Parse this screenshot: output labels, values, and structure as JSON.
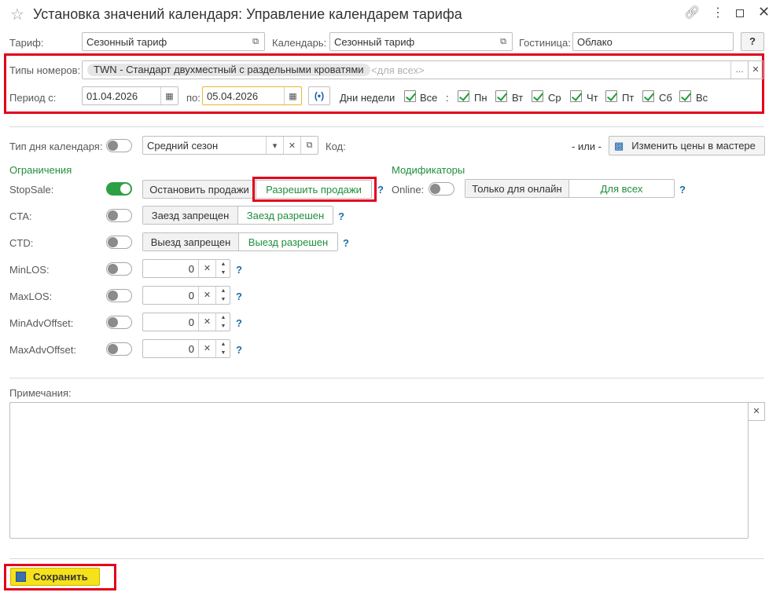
{
  "title": "Установка значений календаря: Управление календарем тарифа",
  "header": {
    "tariff_label": "Тариф:",
    "tariff_value": "Сезонный тариф",
    "calendar_label": "Календарь:",
    "calendar_value": "Сезонный тариф",
    "hotel_label": "Гостиница:",
    "hotel_value": "Облако",
    "help": "?"
  },
  "filters": {
    "room_types_label": "Типы номеров:",
    "room_type_tag": "TWN - Стандарт двухместный с раздельными кроватями",
    "room_types_placeholder": "<для всех>",
    "period_label": "Период с:",
    "date_from": "01.04.2026",
    "to_label": "по:",
    "date_to": "05.04.2026",
    "weekdays_label": "Дни недели",
    "all_label": "Все",
    "colon": ":",
    "days": [
      "Пн",
      "Вт",
      "Ср",
      "Чт",
      "Пт",
      "Сб",
      "Вс"
    ]
  },
  "day_type": {
    "label": "Тип дня календаря:",
    "value": "Средний сезон",
    "code_label": "Код:",
    "or": "- или -",
    "wizard_button": "Изменить цены в мастере"
  },
  "restrictions": {
    "heading": "Ограничения",
    "stopsale": {
      "label": "StopSale:",
      "btn1": "Остановить продажи",
      "btn2": "Разрешить продажи",
      "on": true
    },
    "cta": {
      "label": "CTA:",
      "btn1": "Заезд запрещен",
      "btn2": "Заезд разрешен",
      "on": false
    },
    "ctd": {
      "label": "CTD:",
      "btn1": "Выезд запрещен",
      "btn2": "Выезд разрешен",
      "on": false
    },
    "minlos": {
      "label": "MinLOS:",
      "value": "0"
    },
    "maxlos": {
      "label": "MaxLOS:",
      "value": "0"
    },
    "minadv": {
      "label": "MinAdvOffset:",
      "value": "0"
    },
    "maxadv": {
      "label": "MaxAdvOffset:",
      "value": "0"
    },
    "help": "?"
  },
  "modifiers": {
    "heading": "Модификаторы",
    "online_label": "Online:",
    "btn1": "Только для онлайн",
    "btn2": "Для всех"
  },
  "notes": {
    "label": "Примечания:"
  },
  "save_button": "Сохранить",
  "colors": {
    "accent_green": "#1f8f3c",
    "highlight_red": "#e3001b",
    "save_yellow": "#f5e21b"
  }
}
